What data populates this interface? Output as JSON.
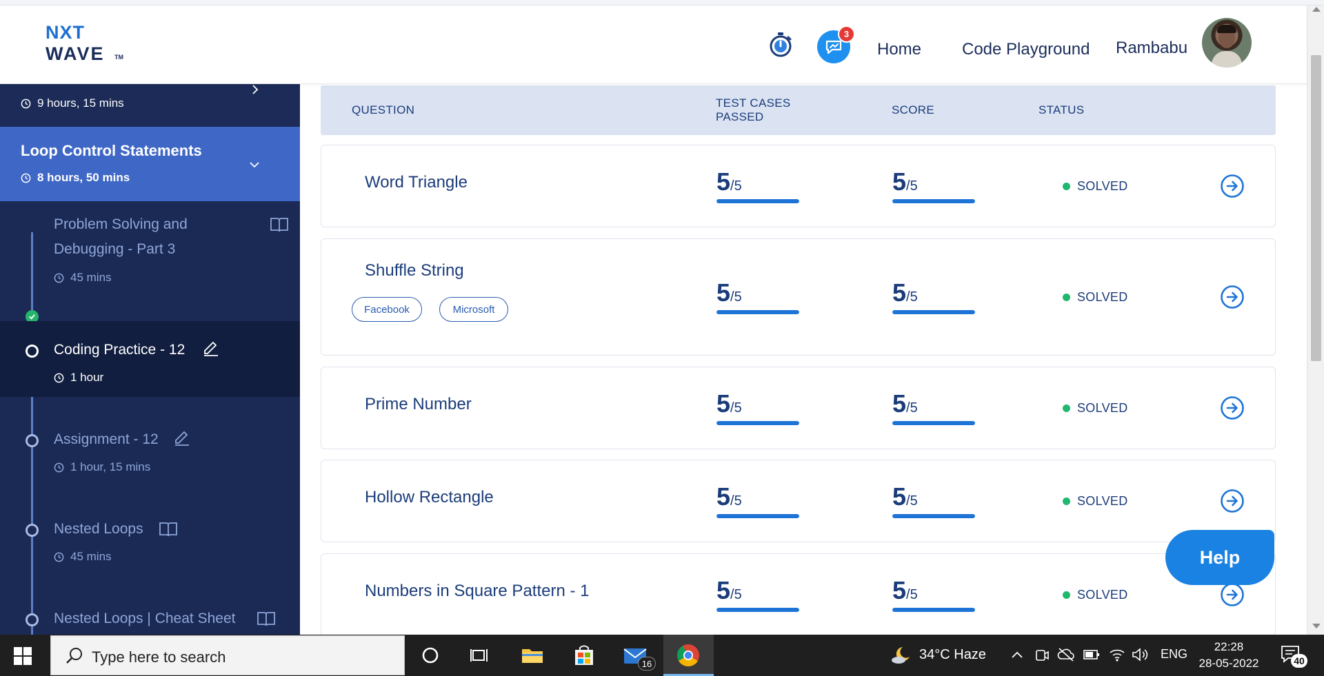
{
  "header": {
    "logo_line1": "NXT",
    "logo_line2": "WAVE",
    "logo_tm": "TM",
    "chat_badge": "3",
    "nav_home": "Home",
    "nav_playground": "Code Playground",
    "user_name": "Rambabu"
  },
  "sidebar": {
    "prev_duration": "9 hours, 15 mins",
    "active_section": {
      "title": "Loop Control Statements",
      "duration": "8 hours, 50 mins"
    },
    "items": [
      {
        "title_line1": "Problem Solving and",
        "title_line2": "Debugging - Part 3",
        "duration": "45 mins",
        "type": "reading",
        "completed": true
      },
      {
        "title_line1": "Coding Practice - 12",
        "duration": "1 hour",
        "type": "practice",
        "current": true
      },
      {
        "title_line1": "Assignment - 12",
        "duration": "1 hour, 15 mins",
        "type": "practice"
      },
      {
        "title_line1": "Nested Loops",
        "duration": "45 mins",
        "type": "reading"
      },
      {
        "title_line1": "Nested Loops | Cheat Sheet",
        "type": "reading"
      }
    ]
  },
  "table": {
    "headers": {
      "question": "QUESTION",
      "tests_line1": "TEST CASES",
      "tests_line2": "PASSED",
      "score": "SCORE",
      "status": "STATUS"
    },
    "rows": [
      {
        "question": "Word Triangle",
        "tests_passed": "5",
        "tests_total": "/5",
        "score": "5",
        "score_total": "/5",
        "tests_fraction": 1.0,
        "score_fraction": 1.0,
        "status": "SOLVED",
        "tags": []
      },
      {
        "question": "Shuffle String",
        "tests_passed": "5",
        "tests_total": "/5",
        "score": "5",
        "score_total": "/5",
        "tests_fraction": 1.0,
        "score_fraction": 1.0,
        "status": "SOLVED",
        "tags": [
          "Facebook",
          "Microsoft"
        ]
      },
      {
        "question": "Prime Number",
        "tests_passed": "5",
        "tests_total": "/5",
        "score": "5",
        "score_total": "/5",
        "tests_fraction": 1.0,
        "score_fraction": 1.0,
        "status": "SOLVED",
        "tags": []
      },
      {
        "question": "Hollow Rectangle",
        "tests_passed": "5",
        "tests_total": "/5",
        "score": "5",
        "score_total": "/5",
        "tests_fraction": 1.0,
        "score_fraction": 1.0,
        "status": "SOLVED",
        "tags": []
      },
      {
        "question": "Numbers in Square Pattern - 1",
        "tests_passed": "5",
        "tests_total": "/5",
        "score": "5",
        "score_total": "/5",
        "tests_fraction": 1.0,
        "score_fraction": 1.0,
        "status": "SOLVED",
        "tags": []
      }
    ]
  },
  "help_label": "Help",
  "taskbar": {
    "search_placeholder": "Type here to search",
    "mail_badge": "16",
    "weather": "34°C  Haze",
    "lang": "ENG",
    "time": "22:28",
    "date": "28-05-2022",
    "notifications": "40"
  },
  "colors": {
    "sidebar_bg": "#1b2a55",
    "active_section_bg": "#3f67c6",
    "accent_blue": "#1e73d6",
    "solved_green": "#1fb86f",
    "text_navy": "#1b3c7a"
  }
}
